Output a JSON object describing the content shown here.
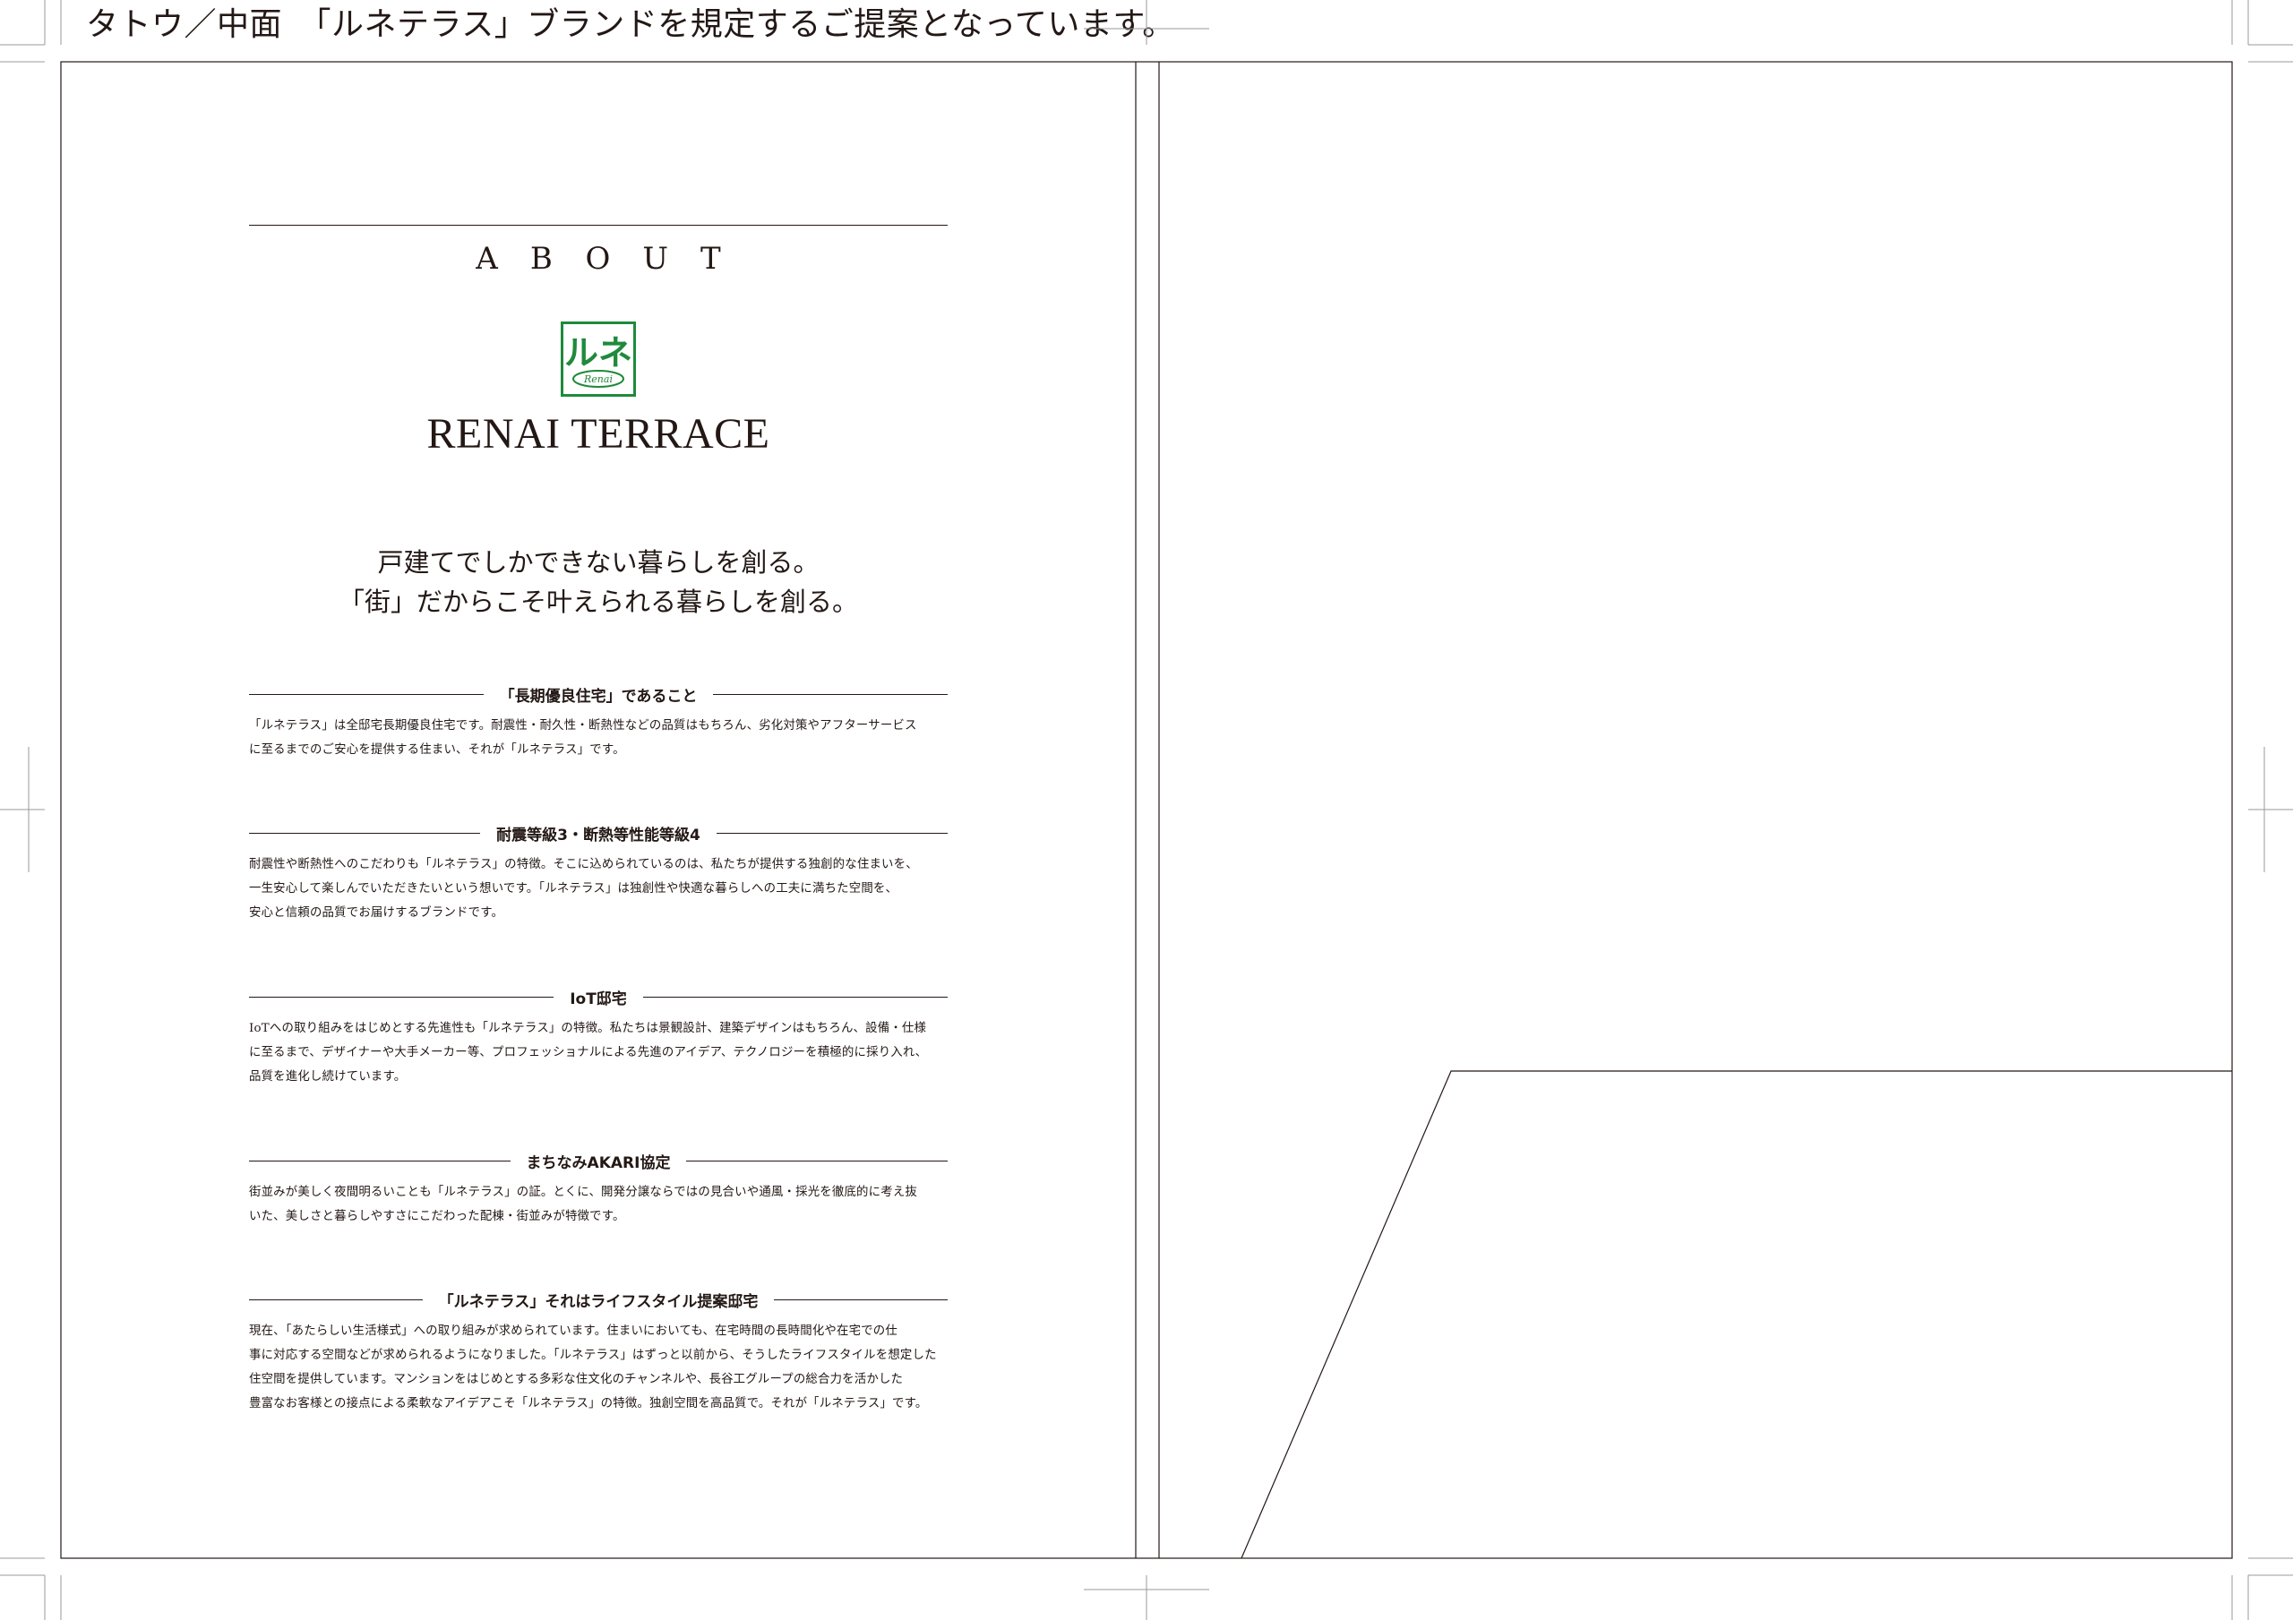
{
  "caption": "タトウ／中面　「ルネテラス」ブランドを規定するご提案となっています。",
  "about": {
    "title": "ABOUT",
    "logo_text": "ルネ",
    "logo_subtext": "Renai",
    "brand_name": "RENAI TERRACE",
    "tagline": [
      "戸建てでしかできない暮らしを創る。",
      "「街」だからこそ叶えられる暮らしを創る。"
    ],
    "sections": [
      {
        "title": "「長期優良住宅」であること",
        "lines": [
          "「ルネテラス」は全邸宅長期優良住宅です。耐震性・耐久性・断熱性などの品質はもちろん、劣化対策やアフターサービス",
          "に至るまでのご安心を提供する住まい、それが「ルネテラス」です。"
        ]
      },
      {
        "title": "耐震等級3・断熱等性能等級4",
        "lines": [
          "耐震性や断熱性へのこだわりも「ルネテラス」の特徴。そこに込められているのは、私たちが提供する独創的な住まいを、",
          "一生安心して楽しんでいただきたいという想いです。「ルネテラス」は独創性や快適な暮らしへの工夫に満ちた空間を、",
          "安心と信頼の品質でお届けするブランドです。"
        ]
      },
      {
        "title": "IoT邸宅",
        "lines": [
          "IoTへの取り組みをはじめとする先進性も「ルネテラス」の特徴。私たちは景観設計、建築デザインはもちろん、設備・仕様",
          "に至るまで、デザイナーや大手メーカー等、プロフェッショナルによる先進のアイデア、テクノロジーを積極的に採り入れ、",
          "品質を進化し続けています。"
        ]
      },
      {
        "title": "まちなみAKARI協定",
        "lines": [
          "街並みが美しく夜間明るいことも「ルネテラス」の証。とくに、開発分譲ならではの見合いや通風・採光を徹底的に考え抜",
          "いた、美しさと暮らしやすさにこだわった配棟・街並みが特徴です。"
        ]
      },
      {
        "title": "「ルネテラス」それはライフスタイル提案邸宅",
        "lines": [
          "現在、「あたらしい生活様式」への取り組みが求められています。住まいにおいても、在宅時間の長時間化や在宅での仕",
          "事に対応する空間などが求められるようになりました。「ルネテラス」はずっと以前から、そうしたライフスタイルを想定した",
          "住空間を提供しています。マンションをはじめとする多彩な住文化のチャンネルや、長谷工グループの総合力を活かした",
          "豊富なお客様との接点による柔軟なアイデアこそ「ルネテラス」の特徴。独創空間を高品質で。それが「ルネテラス」です。"
        ]
      }
    ]
  },
  "colors": {
    "ink": "#231815",
    "logo_green": "#1f8a3c"
  }
}
